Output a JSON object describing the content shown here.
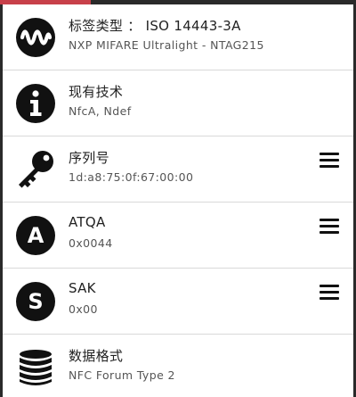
{
  "rows": [
    {
      "title": "标签类型 ： ISO 14443-3A",
      "sub": "NXP MIFARE Ultralight - NTAG215",
      "icon": "waveform-icon"
    },
    {
      "title": "现有技术",
      "sub": "NfcA, Ndef",
      "icon": "info-icon"
    },
    {
      "title": "序列号",
      "sub": "1d:a8:75:0f:67:00:00",
      "icon": "key-icon",
      "menu": true
    },
    {
      "title": "ATQA",
      "sub": "0x0044",
      "icon": "letter-a-icon",
      "menu": true
    },
    {
      "title": "SAK",
      "sub": "0x00",
      "icon": "letter-s-icon",
      "menu": true
    },
    {
      "title": "数据格式",
      "sub": "NFC Forum Type 2",
      "icon": "database-icon"
    }
  ],
  "icons": {
    "letter_a": "A",
    "letter_s": "S"
  },
  "colors": {
    "accent": "#c8404a",
    "frame": "#2a2a2a",
    "icon": "#111111"
  }
}
